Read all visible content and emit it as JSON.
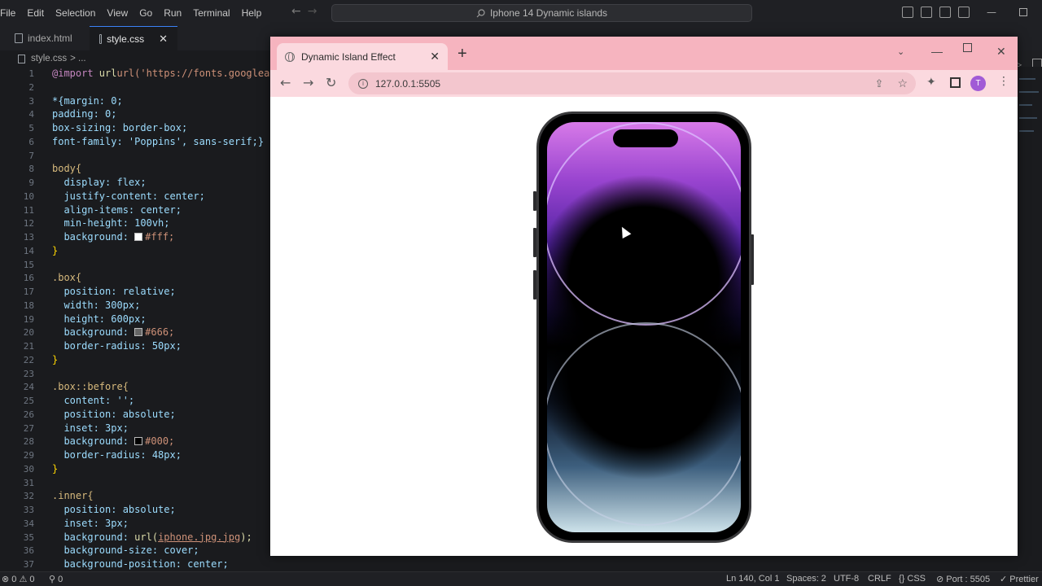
{
  "vscode": {
    "menu": [
      "File",
      "Edit",
      "Selection",
      "View",
      "Go",
      "Run",
      "Terminal",
      "Help"
    ],
    "command_center": "Iphone 14 Dynamic islands",
    "tabs": [
      {
        "label": "index.html",
        "active": false
      },
      {
        "label": "style.css",
        "active": true
      }
    ],
    "breadcrumb": {
      "file": "style.css",
      "rest": "> ..."
    },
    "status": {
      "errors": "0",
      "warnings": "0",
      "ports": "0",
      "position": "Ln 140, Col 1",
      "spaces": "Spaces: 2",
      "encoding": "UTF-8",
      "eol": "CRLF",
      "language": "CSS",
      "port": "Port : 5505",
      "prettier": "Prettier"
    }
  },
  "code_line_numbers": [
    "1",
    "2",
    "3",
    "4",
    "5",
    "6",
    "7",
    "8",
    "9",
    "10",
    "11",
    "12",
    "13",
    "14",
    "15",
    "16",
    "17",
    "18",
    "19",
    "20",
    "21",
    "22",
    "23",
    "24",
    "25",
    "26",
    "27",
    "28",
    "29",
    "30",
    "31",
    "32",
    "33",
    "34",
    "35",
    "36",
    "37"
  ],
  "code": {
    "l1": "url('https://fonts.googleapis.c",
    "l3": "*{margin: 0;",
    "l4": "padding: 0;",
    "l5": "box-sizing: border-box;",
    "l6": "font-family: 'Poppins', sans-serif;}",
    "l8": "body{",
    "l9": "display: flex;",
    "l10": "justify-content: center;",
    "l11": "align-items: center;",
    "l12": "min-height: 100vh;",
    "l13": "#fff;",
    "l14": "}",
    "l16": ".box{",
    "l17": "position: relative;",
    "l18": "width: 300px;",
    "l19": "height: 600px;",
    "l20": "#666;",
    "l21": "border-radius: 50px;",
    "l22": "}",
    "l24": ".box::before{",
    "l25": "content: '';",
    "l26": "position: absolute;",
    "l27": "inset: 3px;",
    "l28": "#000;",
    "l29": "border-radius: 48px;",
    "l30": "}",
    "l32": ".inner{",
    "l33": "position: absolute;",
    "l34": "inset: 3px;",
    "l35": "iphone.jpg.jpg",
    "l36": "background-size: cover;",
    "l37": "background-position: center;"
  },
  "browser": {
    "tab_title": "Dynamic Island Effect",
    "url": "127.0.0.1:5505",
    "avatar_letter": "T"
  },
  "colors": {
    "browser_frame": "#f6b4bf",
    "phone_body": "#3a3a3c",
    "accent": "#3b82f6"
  }
}
